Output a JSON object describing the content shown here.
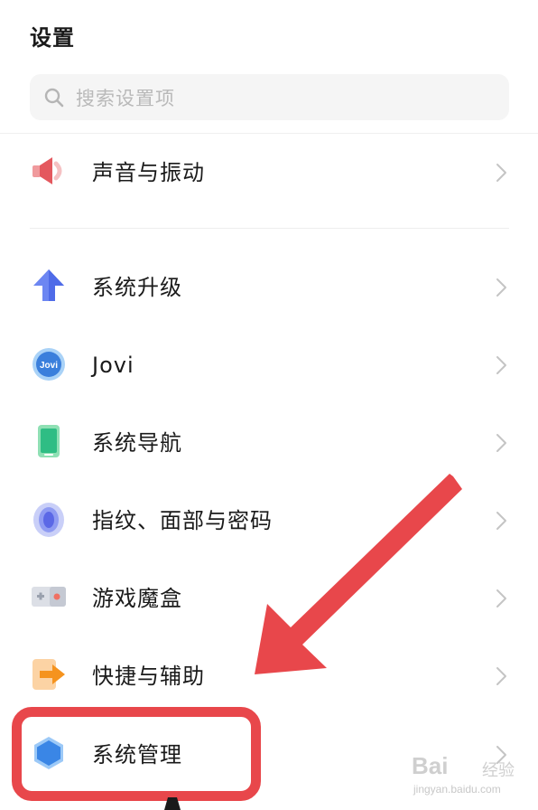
{
  "header": {
    "title": "设置"
  },
  "search": {
    "placeholder": "搜索设置项",
    "icon": "search-icon"
  },
  "settings": {
    "items": [
      {
        "label": "声音与振动",
        "icon": "speaker-icon",
        "color": "#e8656a"
      },
      {
        "label": "系统升级",
        "icon": "upgrade-arrow-icon",
        "color": "#5b7cf0"
      },
      {
        "label": "Jovi",
        "icon": "jovi-icon",
        "color": "#3d8be0"
      },
      {
        "label": "系统导航",
        "icon": "phone-navigation-icon",
        "color": "#3cc38a"
      },
      {
        "label": "指纹、面部与密码",
        "icon": "fingerprint-icon",
        "color": "#6f7ff0"
      },
      {
        "label": "游戏魔盒",
        "icon": "gamepad-icon",
        "color": "#f07063"
      },
      {
        "label": "快捷与辅助",
        "icon": "shortcut-arrow-icon",
        "color": "#f59a3a"
      },
      {
        "label": "系统管理",
        "icon": "system-hexagon-icon",
        "color": "#3a86e6"
      }
    ]
  },
  "annotation": {
    "color": "#e8474b"
  },
  "watermark": {
    "brand": "Bai",
    "brand_cn": "经验",
    "url": "jingyan.baidu.com"
  }
}
